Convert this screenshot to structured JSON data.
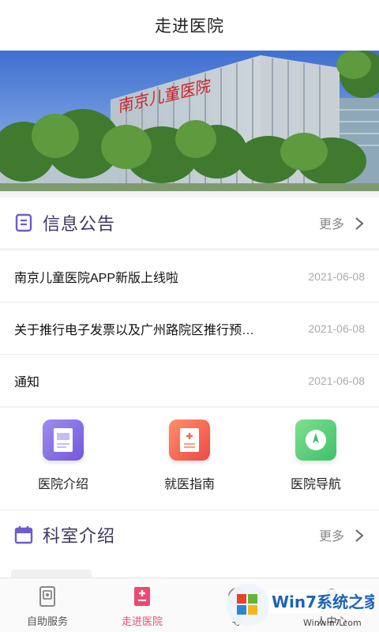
{
  "header": {
    "title": "走进医院"
  },
  "banner": {
    "sign_text": "南京儿童医院"
  },
  "notice": {
    "title": "信息公告",
    "more": "更多",
    "items": [
      {
        "title": "南京儿童医院APP新版上线啦",
        "date": "2021-06-08"
      },
      {
        "title": "关于推行电子发票以及广州路院区推行预…",
        "date": "2021-06-08"
      },
      {
        "title": "通知",
        "date": "2021-06-08"
      }
    ]
  },
  "quick_links": [
    {
      "label": "医院介绍",
      "icon": "document-icon",
      "color": "#8a6fe0"
    },
    {
      "label": "就医指南",
      "icon": "medical-report-icon",
      "color": "#f26b50"
    },
    {
      "label": "医院导航",
      "icon": "compass-icon",
      "color": "#4bcf7a"
    }
  ],
  "departments": {
    "title": "科室介绍",
    "more": "更多"
  },
  "tabbar": {
    "items": [
      {
        "label": "自助服务",
        "icon": "self-service-icon"
      },
      {
        "label": "走进医院",
        "icon": "hospital-info-icon",
        "active": true
      },
      {
        "label": "导",
        "icon": "navigation-icon"
      },
      {
        "label": "人中心",
        "icon": "user-center-icon"
      }
    ]
  },
  "watermark": {
    "brand": "Win7系统之家",
    "url": "Winwin7.com"
  },
  "colors": {
    "accent_purple": "#6e5bd1",
    "accent_pink": "#ec4a72",
    "text_purple": "#3e3560"
  }
}
